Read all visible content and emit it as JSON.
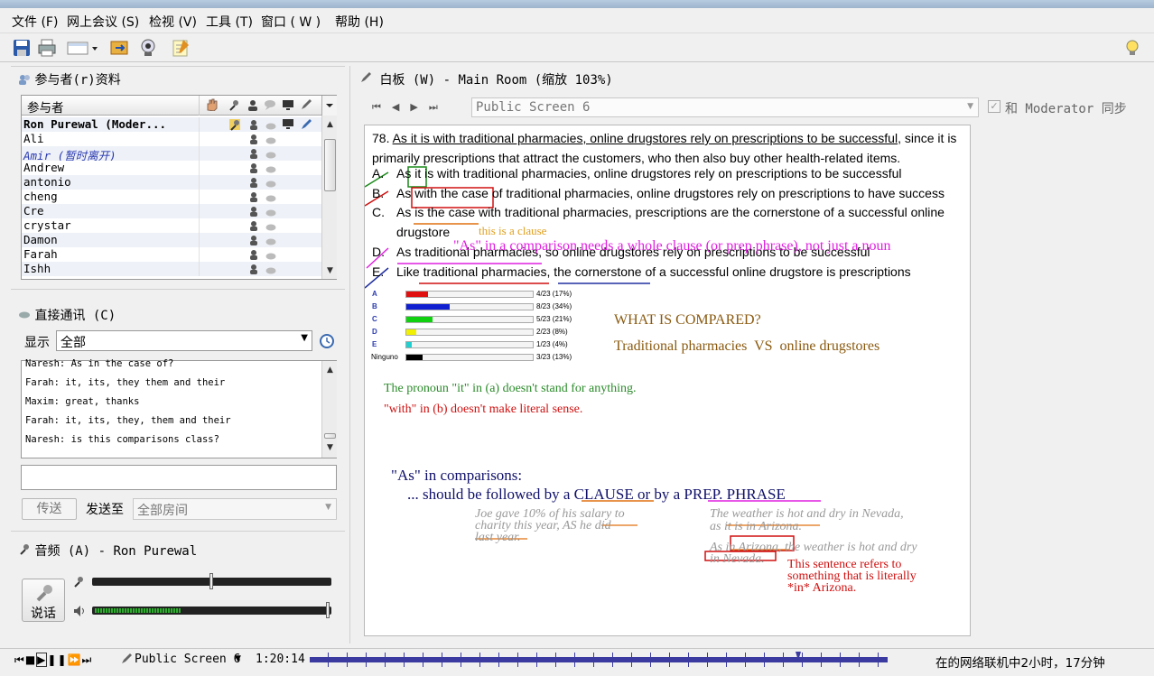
{
  "menu": [
    "文件 (F)",
    "网上会议 (S)",
    "检视 (V)",
    "工具 (T)",
    "窗口 ( W )",
    "帮助 (H)"
  ],
  "participants_panel": {
    "title": "参与者(r)资料",
    "column_header": "参与者",
    "rows": [
      {
        "name": "Ron Purewal (Moder...",
        "style": "bold"
      },
      {
        "name": "Ali",
        "style": "normal"
      },
      {
        "name": "Amir (暂时离开)",
        "style": "away"
      },
      {
        "name": "Andrew",
        "style": "normal"
      },
      {
        "name": "antonio",
        "style": "normal"
      },
      {
        "name": "cheng",
        "style": "normal"
      },
      {
        "name": "Cre",
        "style": "normal"
      },
      {
        "name": "crystar",
        "style": "normal"
      },
      {
        "name": "Damon",
        "style": "normal"
      },
      {
        "name": "Farah",
        "style": "normal"
      },
      {
        "name": "Ishh",
        "style": "normal"
      }
    ]
  },
  "chat_panel": {
    "title": "直接通讯 (C)",
    "show_label": "显示",
    "show_value": "全部",
    "messages": [
      "Naresh: As in the case of?",
      "Farah: it, its, they them and their",
      "Maxim: great, thanks",
      "Farah: it, its, they, them and their",
      "Naresh: is this comparisons class?"
    ],
    "input_value": "",
    "send_button": "传送",
    "send_to_label": "发送至",
    "send_to_value": "全部房间"
  },
  "audio_panel": {
    "title": "音频 (A) - Ron Purewal",
    "talk_button": "说话",
    "mic_level": 0.5,
    "speaker_level": 1.0
  },
  "whiteboard": {
    "title": "白板 (W) - Main Room (缩放 103%)",
    "screen_select": "Public Screen 6",
    "sync_label": "和 Moderator 同步",
    "sync_checked": true,
    "question": {
      "number": "78.",
      "stem_underlined": "As it is with traditional pharmacies, online drugstores rely on prescriptions to be successful",
      "stem_rest": ", since it is",
      "stem_line2": "primarily prescriptions that attract the customers, who then also buy other health-related items.",
      "choices": [
        {
          "letter": "A.",
          "text": "As it is with traditional pharmacies, online drugstores rely on prescriptions to be successful"
        },
        {
          "letter": "B.",
          "text": "As with the case of traditional pharmacies, online drugstores rely on prescriptions to have success"
        },
        {
          "letter": "C.",
          "text": "As is the case with traditional pharmacies, prescriptions are the cornerstone of a successful online"
        },
        {
          "letter": "",
          "text": "drugstore"
        },
        {
          "letter": "D.",
          "text": "As traditional pharmacies, so online drugstores rely on prescriptions to be successful"
        },
        {
          "letter": "E.",
          "text": "Like traditional pharmacies, the cornerstone of a successful online drugstore is prescriptions"
        }
      ]
    },
    "poll": [
      {
        "label": "A",
        "text": "4/23 (17%)",
        "frac": 0.17,
        "color": "#e01010"
      },
      {
        "label": "B",
        "text": "8/23 (34%)",
        "frac": 0.34,
        "color": "#1020d0"
      },
      {
        "label": "C",
        "text": "5/23 (21%)",
        "frac": 0.21,
        "color": "#10d010"
      },
      {
        "label": "D",
        "text": "2/23 (8%)",
        "frac": 0.08,
        "color": "#f0f000"
      },
      {
        "label": "E",
        "text": "1/23 (4%)",
        "frac": 0.04,
        "color": "#20d0d0"
      },
      {
        "label": "Ninguno",
        "text": "3/23 (13%)",
        "frac": 0.13,
        "color": "#000000"
      }
    ],
    "annotations": {
      "clause_note": "this is a clause",
      "as_note": "\"As\" in a comparison needs a whole clause (or prep phrase), not just a noun",
      "what_compared": "WHAT IS COMPARED?",
      "traditional_vs": "Traditional pharmacies  VS  online drugstores",
      "pronoun_note": "The pronoun \"it\" in (a) doesn't stand for anything.",
      "with_note": "\"with\" in (b) doesn't make literal sense.",
      "as_in_comparisons": "\"As\" in comparisons:",
      "should_be": "... should be followed by a CLAUSE or by a PREP. PHRASE",
      "joe_l1": "Joe gave 10% of his salary to",
      "joe_l2": "charity this year, AS he did",
      "joe_l3": "last year.",
      "weather_l1": "The weather is hot and dry in Nevada,",
      "weather_l2": "as it is in Arizona.",
      "arizona_l1": "As in Arizona, the weather is hot and dry",
      "arizona_l2": "in Nevada.",
      "refers_l1": "This sentence refers to",
      "refers_l2": "something that is literally",
      "refers_l3": "*in* Arizona."
    }
  },
  "statusbar": {
    "screen": "Public Screen 6",
    "time": "1:20:14",
    "status": "在的网络联机中2小时，17分钟"
  },
  "colors": {
    "annotation_magenta": "#e020e0",
    "annotation_green": "#2a8a2a",
    "annotation_red": "#d01010",
    "annotation_brown": "#8a5a10",
    "annotation_navy": "#10106a"
  }
}
